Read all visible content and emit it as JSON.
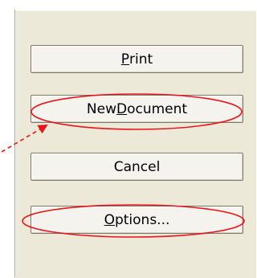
{
  "buttons": {
    "print": {
      "pre": "",
      "accel": "P",
      "post": "rint"
    },
    "new_document": {
      "pre": "New ",
      "accel": "D",
      "post": "ocument"
    },
    "cancel": {
      "pre": "Cancel",
      "accel": "",
      "post": ""
    },
    "options": {
      "pre": "",
      "accel": "O",
      "post": "ptions..."
    }
  },
  "annotations": {
    "color": "#e8141c",
    "highlighted": [
      "new_document",
      "options"
    ],
    "arrow_target": "new_document"
  },
  "colors": {
    "dialog_background": "#ece9d8",
    "button_face": "#f4f3ee",
    "button_border": "#7b7866"
  }
}
